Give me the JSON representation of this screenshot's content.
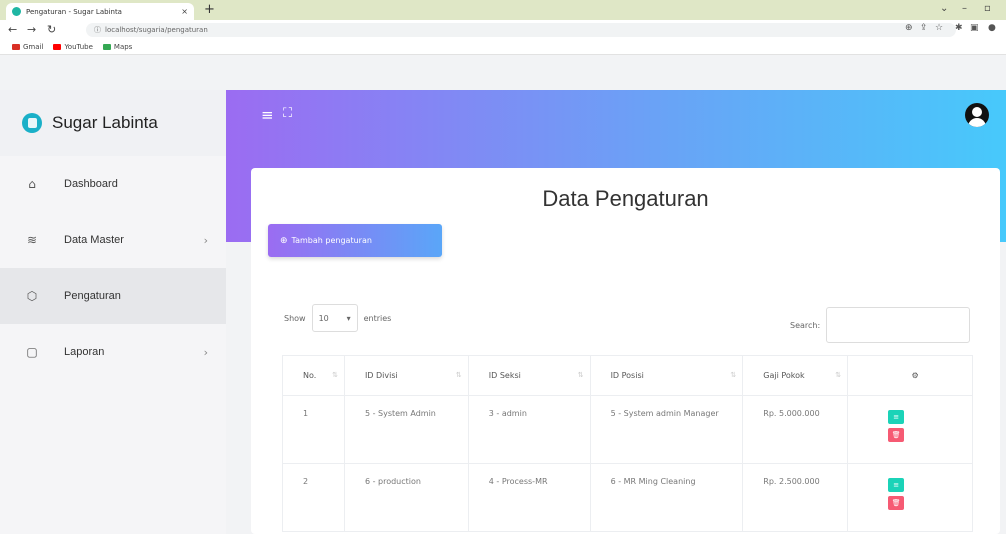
{
  "browser": {
    "tab_title": "Pengaturan - Sugar Labinta",
    "tab_close": "×",
    "new_tab": "+",
    "url": "localhost/sugaria/pengaturan",
    "bookmarks": [
      {
        "label": "Gmail",
        "color": "#d93025"
      },
      {
        "label": "YouTube",
        "color": "#ff0000"
      },
      {
        "label": "Maps",
        "color": "#34a853"
      }
    ]
  },
  "sidebar": {
    "brand": "Sugar Labinta",
    "items": [
      {
        "label": "Dashboard",
        "icon": "⌂",
        "chevron": ""
      },
      {
        "label": "Data Master",
        "icon": "≋",
        "chevron": "›"
      },
      {
        "label": "Pengaturan",
        "icon": "⬡",
        "chevron": ""
      },
      {
        "label": "Laporan",
        "icon": "▢",
        "chevron": "›"
      }
    ],
    "active_index": 2
  },
  "header": {
    "menu_icon": "≡",
    "fullscreen_icon": "⛶"
  },
  "main": {
    "title": "Data Pengaturan",
    "add_button": "Tambah pengaturan",
    "add_icon": "⊕",
    "show_label": "Show",
    "entries_value": "10",
    "entries_label": "entries",
    "search_label": "Search:"
  },
  "table": {
    "headers": [
      "No.",
      "ID Divisi",
      "ID Seksi",
      "ID Posisi",
      "Gaji Pokok",
      "⚙"
    ],
    "rows": [
      {
        "no": "1",
        "divisi": "5 - System Admin",
        "seksi": "3 - admin",
        "posisi": "5 - System admin Manager",
        "gaji": "Rp. 5.000.000"
      },
      {
        "no": "2",
        "divisi": "6 - production",
        "seksi": "4 - Process-MR",
        "posisi": "6 - MR Ming Cleaning",
        "gaji": "Rp. 2.500.000"
      }
    ],
    "edit_icon": "≡",
    "delete_icon": "🗑"
  }
}
